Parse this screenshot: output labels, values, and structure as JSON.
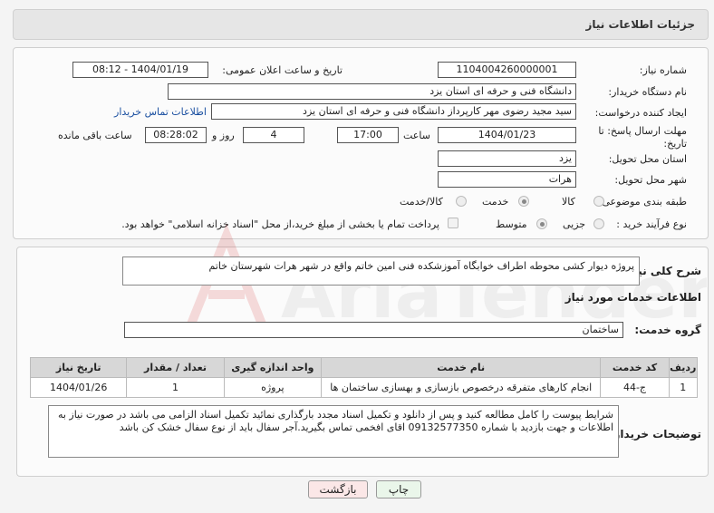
{
  "header": {
    "title": "جزئیات اطلاعات نیاز"
  },
  "form": {
    "need_number": {
      "label": "شماره نیاز:",
      "value": "1104004260000001"
    },
    "announce_datetime": {
      "label": "تاریخ و ساعت اعلان عمومی:",
      "value": "1404/01/19 - 08:12"
    },
    "buyer_org": {
      "label": "نام دستگاه خریدار:",
      "value": "دانشگاه فنی و حرفه ای استان یزد"
    },
    "requester": {
      "label": "ایجاد کننده درخواست:",
      "value": "سید مجید رضوی مهر کارپرداز دانشگاه فنی و حرفه ای استان یزد",
      "contact_link": "اطلاعات تماس خریدار"
    },
    "deadline": {
      "label_line1": "مهلت ارسال پاسخ: تا",
      "label_line2": "تاریخ:",
      "date": "1404/01/23",
      "time_label": "ساعت",
      "time": "17:00",
      "days": "4",
      "days_label": "روز و",
      "remaining": "08:28:02",
      "remaining_label": "ساعت باقی مانده"
    },
    "province": {
      "label": "استان محل تحویل:",
      "value": "یزد"
    },
    "city": {
      "label": "شهر محل تحویل:",
      "value": "هرات"
    },
    "category": {
      "label": "طبقه بندی موضوعی:",
      "options": [
        "کالا",
        "خدمت",
        "کالا/خدمت"
      ],
      "selected": "خدمت"
    },
    "purchase_type": {
      "label": "نوع فرآیند خرید :",
      "options": [
        "جزیی",
        "متوسط"
      ],
      "selected": "متوسط",
      "payment_note": "پرداخت تمام یا بخشی از مبلغ خرید،از محل \"اسناد خزانه اسلامی\" خواهد بود."
    }
  },
  "description": {
    "label": "شرح کلی نیاز:",
    "value": "پروژه دیوار کشی محوطه اطراف خوابگاه آموزشکده فنی امین خاتم واقع در شهر هرات شهرستان خاتم"
  },
  "services": {
    "section_title": "اطلاعات خدمات مورد نیاز",
    "group_label": "گروه خدمت:",
    "group_value": "ساختمان",
    "columns": [
      "ردیف",
      "کد خدمت",
      "نام خدمت",
      "واحد اندازه گیری",
      "تعداد / مقدار",
      "تاریخ نیاز"
    ],
    "rows": [
      [
        "1",
        "ج-44",
        "انجام کارهای متفرقه درخصوص بازسازی و بهسازی ساختمان ها",
        "پروژه",
        "1",
        "1404/01/26"
      ]
    ]
  },
  "buyer_notes": {
    "label": "توضیحات خریدار:",
    "value": "شرایط پیوست را کامل مطالعه کنید و پس از دانلود و تکمیل اسناد مجدد بارگذاری نمائید تکمیل اسناد الزامی می باشد در صورت نیاز به اطلاعات و جهت بازدید با شماره   09132577350 اقای افخمی تماس بگیرید.آجر سفال باید از نوع سفال خشک کن باشد"
  },
  "actions": {
    "print": "چاپ",
    "back": "بازگشت"
  },
  "watermark": {
    "text": "AriaTender.neT"
  }
}
